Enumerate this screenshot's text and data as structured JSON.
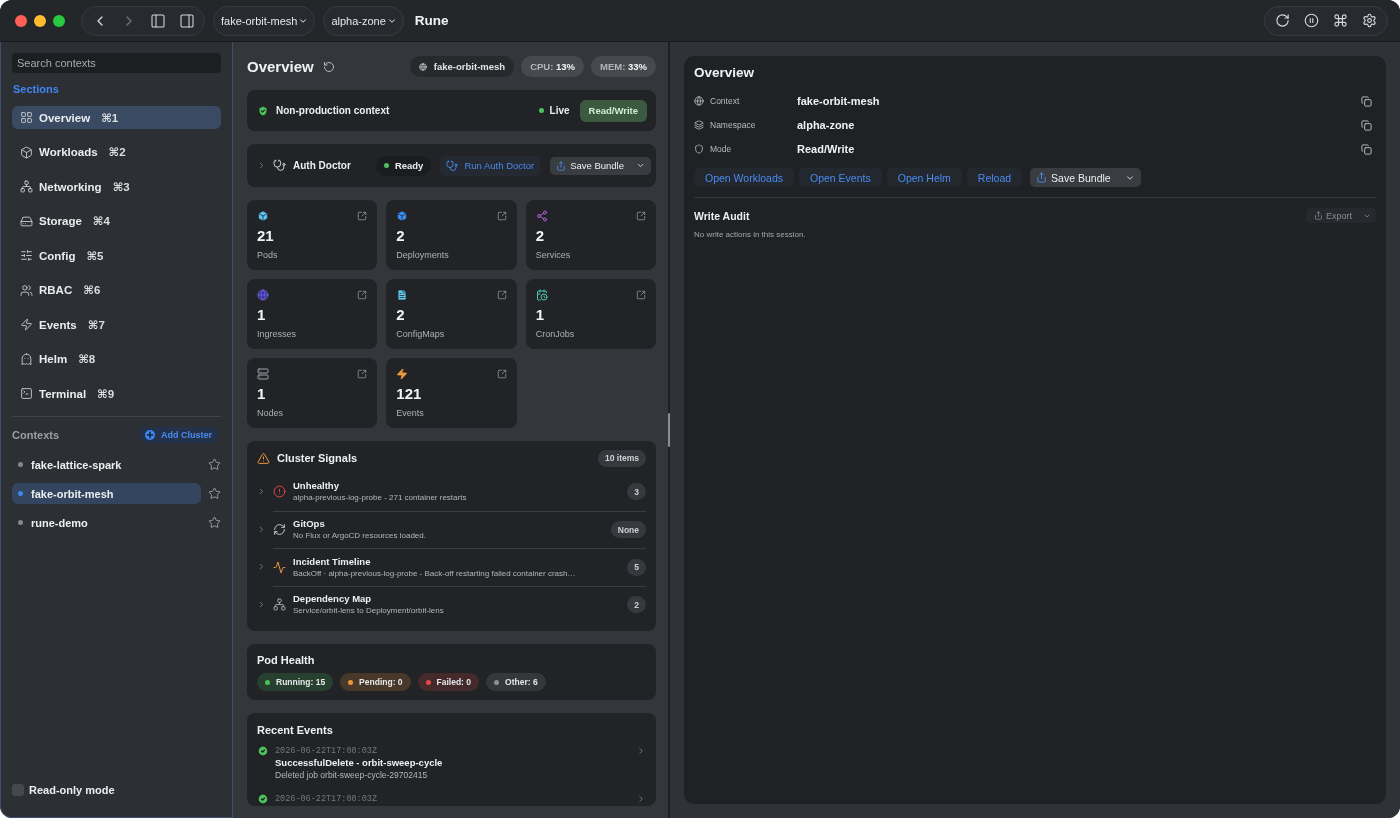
{
  "window": {
    "back_disabled": false,
    "forward_disabled": true,
    "context_picker": "fake-orbit-mesh",
    "namespace_picker": "alpha-zone",
    "title": "Rune"
  },
  "sidebar": {
    "search": {
      "placeholder": "Search contexts"
    },
    "sections_heading": "Sections",
    "sections": [
      {
        "label": "Overview",
        "shortcut": "⌘1",
        "selected": true
      },
      {
        "label": "Workloads",
        "shortcut": "⌘2",
        "selected": false
      },
      {
        "label": "Networking",
        "shortcut": "⌘3",
        "selected": false
      },
      {
        "label": "Storage",
        "shortcut": "⌘4",
        "selected": false
      },
      {
        "label": "Config",
        "shortcut": "⌘5",
        "selected": false
      },
      {
        "label": "RBAC",
        "shortcut": "⌘6",
        "selected": false
      },
      {
        "label": "Events",
        "shortcut": "⌘7",
        "selected": false
      },
      {
        "label": "Helm",
        "shortcut": "⌘8",
        "selected": false
      },
      {
        "label": "Terminal",
        "shortcut": "⌘9",
        "selected": false
      }
    ],
    "contexts_heading": "Contexts",
    "add_cluster": "Add Cluster",
    "contexts": [
      {
        "name": "fake-lattice-spark",
        "selected": false,
        "starred": false
      },
      {
        "name": "fake-orbit-mesh",
        "selected": true,
        "starred": false
      },
      {
        "name": "rune-demo",
        "selected": false,
        "starred": false
      }
    ],
    "read_only": {
      "label": "Read-only mode",
      "checked": false
    }
  },
  "overview": {
    "title": "Overview",
    "context_tag": "fake-orbit-mesh",
    "cpu": "CPU: **13%**",
    "memory": "MEM: **33%**",
    "environment": {
      "label": "Non-production context",
      "status": "Live",
      "mode_button": "Read/Write"
    },
    "auth_doctor": {
      "title": "Auth Doctor",
      "expanded": false,
      "status": "Ready",
      "run_button": "Run Auth Doctor",
      "save_button": "Save Bundle"
    },
    "stats": [
      {
        "count": "21",
        "label": "Pods"
      },
      {
        "count": "2",
        "label": "Deployments"
      },
      {
        "count": "2",
        "label": "Services"
      },
      {
        "count": "1",
        "label": "Ingresses"
      },
      {
        "count": "2",
        "label": "ConfigMaps"
      },
      {
        "count": "1",
        "label": "CronJobs"
      },
      {
        "count": "1",
        "label": "Nodes"
      },
      {
        "count": "121",
        "label": "Events"
      }
    ],
    "signals": {
      "title": "Cluster Signals",
      "count": "10 items",
      "rows": [
        {
          "title": "Unhealthy",
          "detail": "alpha-previous-log-probe - 271 container restarts",
          "badge": "3",
          "expanded": false
        },
        {
          "title": "GitOps",
          "detail": "No Flux or ArgoCD resources loaded.",
          "badge": "None",
          "expanded": false
        },
        {
          "title": "Incident Timeline",
          "detail": "BackOff · alpha-previous-log-probe - Back-off restarting failed container crash…",
          "badge": "5",
          "expanded": false
        },
        {
          "title": "Dependency Map",
          "detail": "Service/orbit-lens to Deployment/orbit-lens",
          "badge": "2",
          "expanded": false
        }
      ]
    },
    "pod_health": {
      "title": "Pod Health",
      "phases": [
        {
          "label": "Running: 15",
          "color": "#4cc15c"
        },
        {
          "label": "Pending: 0",
          "color": "#f0953a"
        },
        {
          "label": "Failed: 0",
          "color": "#e5484d"
        },
        {
          "label": "Other: 6",
          "color": "#8e9296"
        }
      ]
    },
    "recent_events": {
      "title": "Recent Events",
      "events": [
        {
          "time": "2026-06-22T17:00:03Z",
          "title": "SuccessfulDelete - orbit-sweep-cycle",
          "detail": "Deleted job orbit-sweep-cycle-29702415"
        },
        {
          "time": "2026-06-22T17:00:03Z"
        }
      ]
    }
  },
  "details": {
    "title": "Overview",
    "fields": [
      {
        "label": "Context",
        "value": "fake-orbit-mesh"
      },
      {
        "label": "Namespace",
        "value": "alpha-zone"
      },
      {
        "label": "Mode",
        "value": "Read/Write"
      }
    ],
    "actions": [
      "Open Workloads",
      "Open Events",
      "Open Helm",
      "Reload"
    ],
    "save_button": "Save Bundle",
    "audit": {
      "title": "Write Audit",
      "export_button": {
        "label": "Export",
        "disabled": true
      },
      "empty_text": "No write actions in this session."
    }
  }
}
